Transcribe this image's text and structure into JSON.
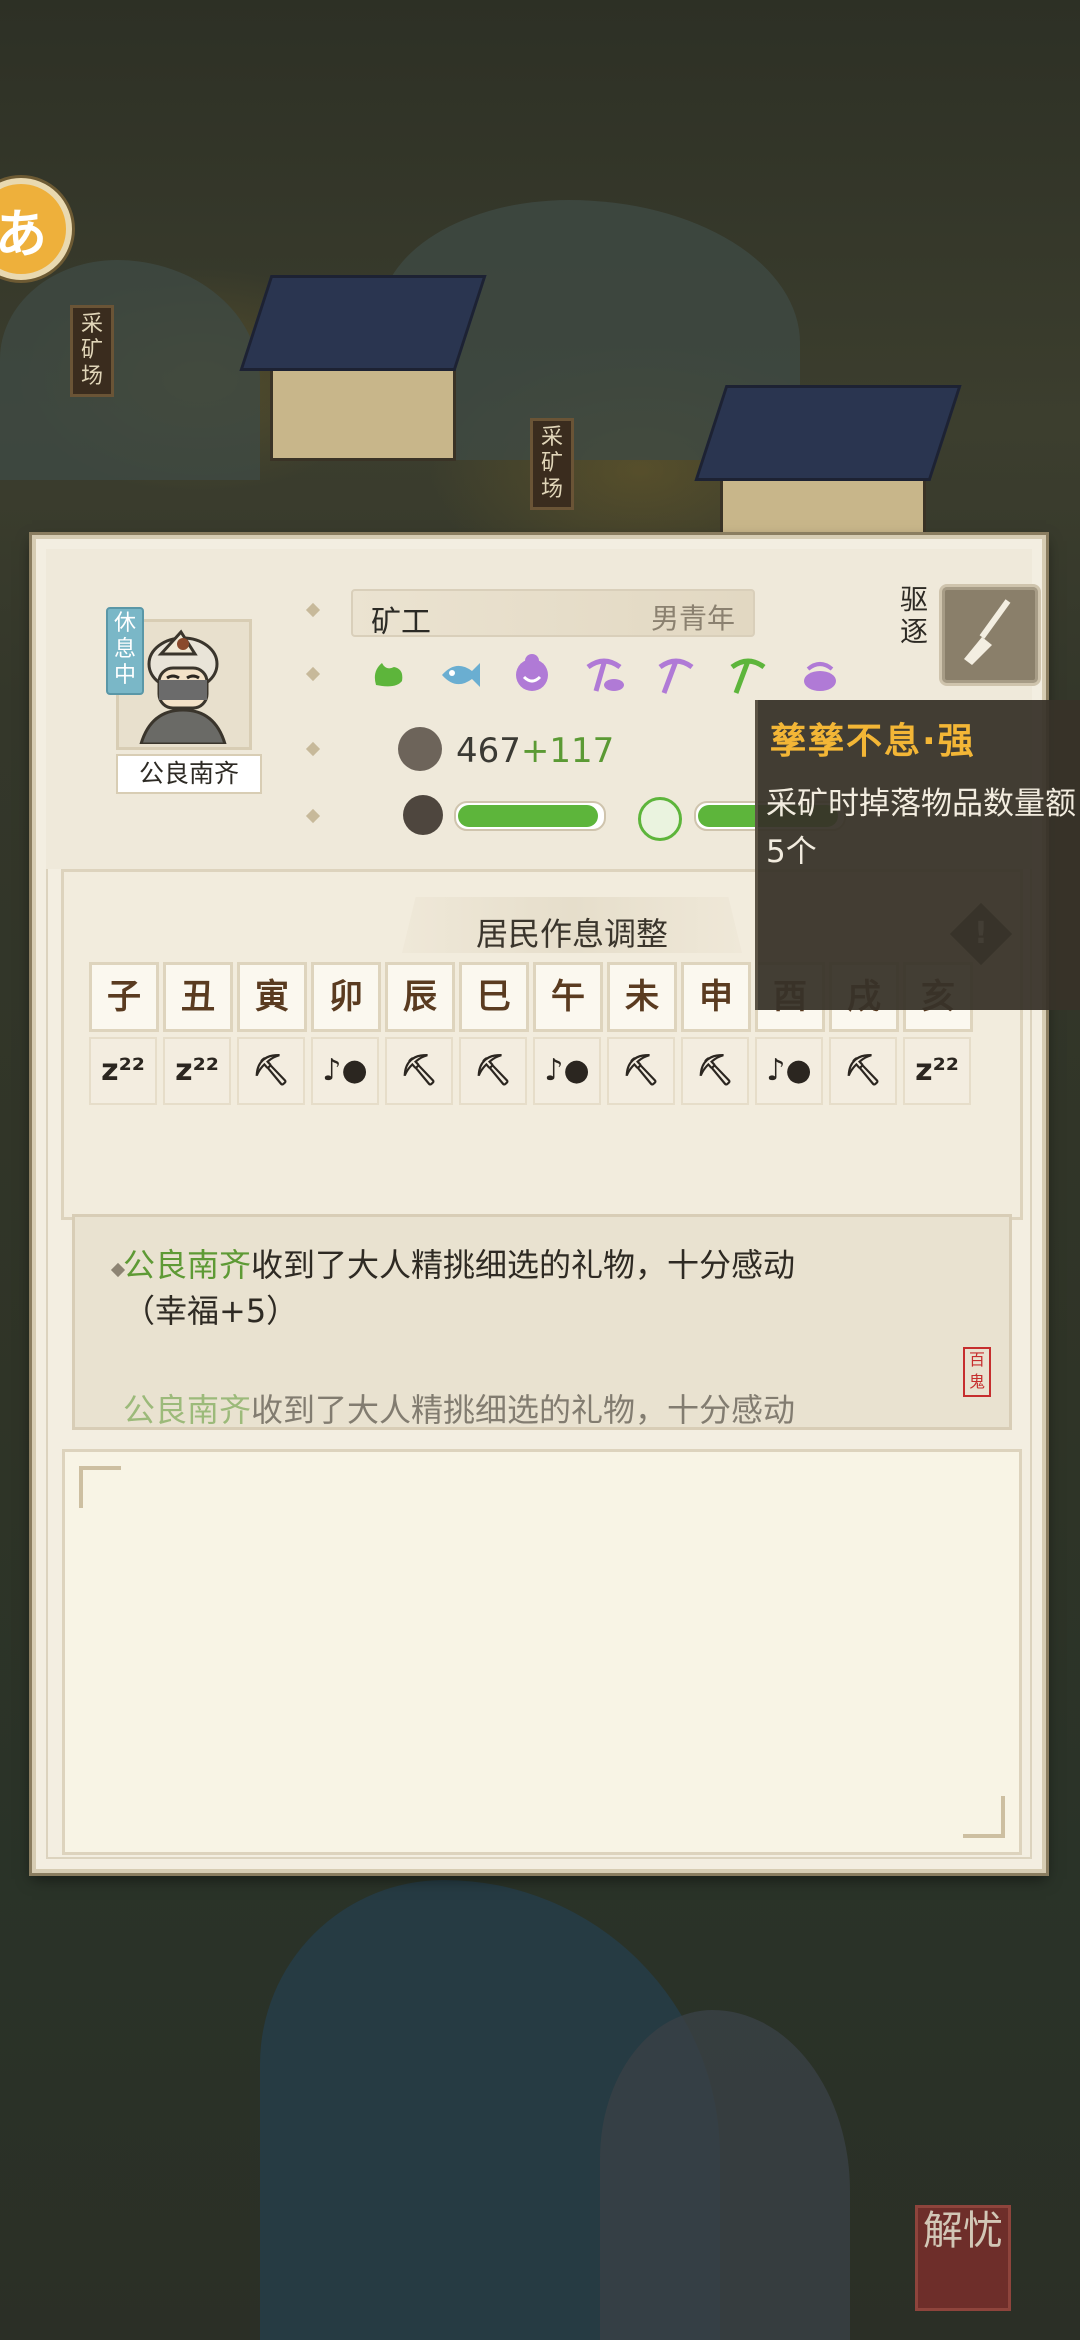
{
  "character": {
    "status_tag": "休息中",
    "name": "公良南齐",
    "job": "矿工",
    "profile": "男青年",
    "power": "467",
    "power_bonus": "+117",
    "expel_label": "驱逐",
    "traits": [
      {
        "icon": "strength-arm-icon",
        "color": "#5db53b"
      },
      {
        "icon": "fish-icon",
        "color": "#6aaed1"
      },
      {
        "icon": "face-icon",
        "color": "#b07ad6"
      },
      {
        "icon": "ore-pick-icon",
        "color": "#b07ad6"
      },
      {
        "icon": "pickaxe-icon",
        "color": "#b07ad6"
      },
      {
        "icon": "pickaxe-icon",
        "color": "#5db53b"
      },
      {
        "icon": "ore-pile-icon",
        "color": "#b07ad6"
      }
    ],
    "happiness_fill": 1.0,
    "vitality_fill": 1.0
  },
  "tooltip": {
    "title": "孳孳不息·强",
    "line1": "采矿时掉落物品数量额",
    "line2": "5个"
  },
  "schedule": {
    "title": "居民作息调整",
    "hours": [
      "子",
      "丑",
      "寅",
      "卯",
      "辰",
      "巳",
      "午",
      "未",
      "申",
      "酉",
      "戌",
      "亥"
    ],
    "activities": [
      "sleep",
      "sleep",
      "work",
      "leisure",
      "work",
      "work",
      "leisure",
      "work",
      "work",
      "leisure",
      "work",
      "sleep"
    ],
    "labels": {
      "sleep": "z²²",
      "work": "⛏",
      "leisure": "♪●"
    }
  },
  "log": {
    "entries": [
      {
        "name": "公良南齐",
        "text": "收到了大人精挑细选的礼物，十分感动",
        "text2": "（幸福+5）"
      },
      {
        "name": "公良南齐",
        "text": "收到了大人精挑细选的礼物，十分感动",
        "text2": ""
      }
    ],
    "seal": "百鬼"
  },
  "scene": {
    "sign1": "采矿场",
    "sign2": "采矿场",
    "side_button": "あ",
    "corner_logo": "解忧"
  }
}
